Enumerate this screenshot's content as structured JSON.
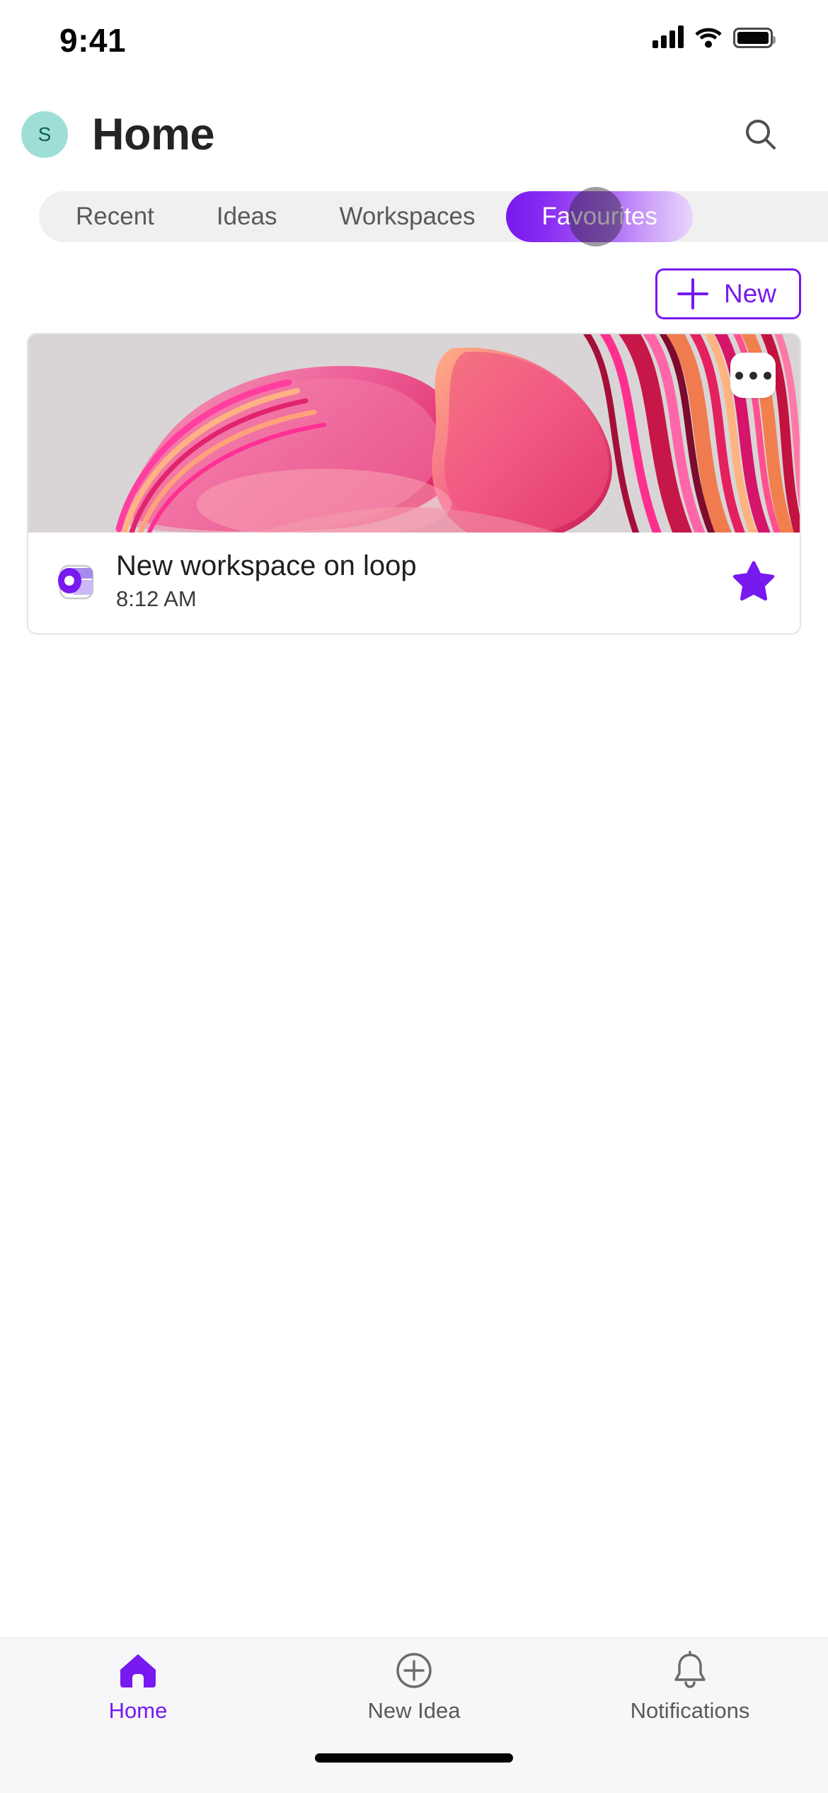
{
  "status_bar": {
    "time": "9:41",
    "cellular_icon": "cellular-bars-icon",
    "wifi_icon": "wifi-icon",
    "battery_icon": "battery-full-icon"
  },
  "header": {
    "avatar_initial": "S",
    "avatar_color": "#9fded6",
    "title": "Home",
    "search_icon": "search-icon"
  },
  "tabs": {
    "items": [
      {
        "label": "Recent",
        "active": false
      },
      {
        "label": "Ideas",
        "active": false
      },
      {
        "label": "Workspaces",
        "active": false
      },
      {
        "label": "Favourites",
        "active": true
      }
    ],
    "active_index": 3,
    "active_color": "#7719ef",
    "bar_background": "#f1f0f0"
  },
  "toolbar": {
    "new_label": "New",
    "new_icon": "plus-icon",
    "accent_color": "#7719ef"
  },
  "cards": [
    {
      "title": "New workspace on loop",
      "time": "8:12 AM",
      "app_icon": "loop-app-icon",
      "more_icon": "more-options-icon",
      "favourite_icon": "star-filled-icon",
      "favourite": true
    }
  ],
  "bottom_nav": {
    "items": [
      {
        "label": "Home",
        "icon": "home-icon",
        "active": true
      },
      {
        "label": "New Idea",
        "icon": "plus-circle-icon",
        "active": false
      },
      {
        "label": "Notifications",
        "icon": "bell-icon",
        "active": false
      }
    ],
    "active_color": "#7719ef",
    "inactive_color": "#5a5a5a"
  }
}
